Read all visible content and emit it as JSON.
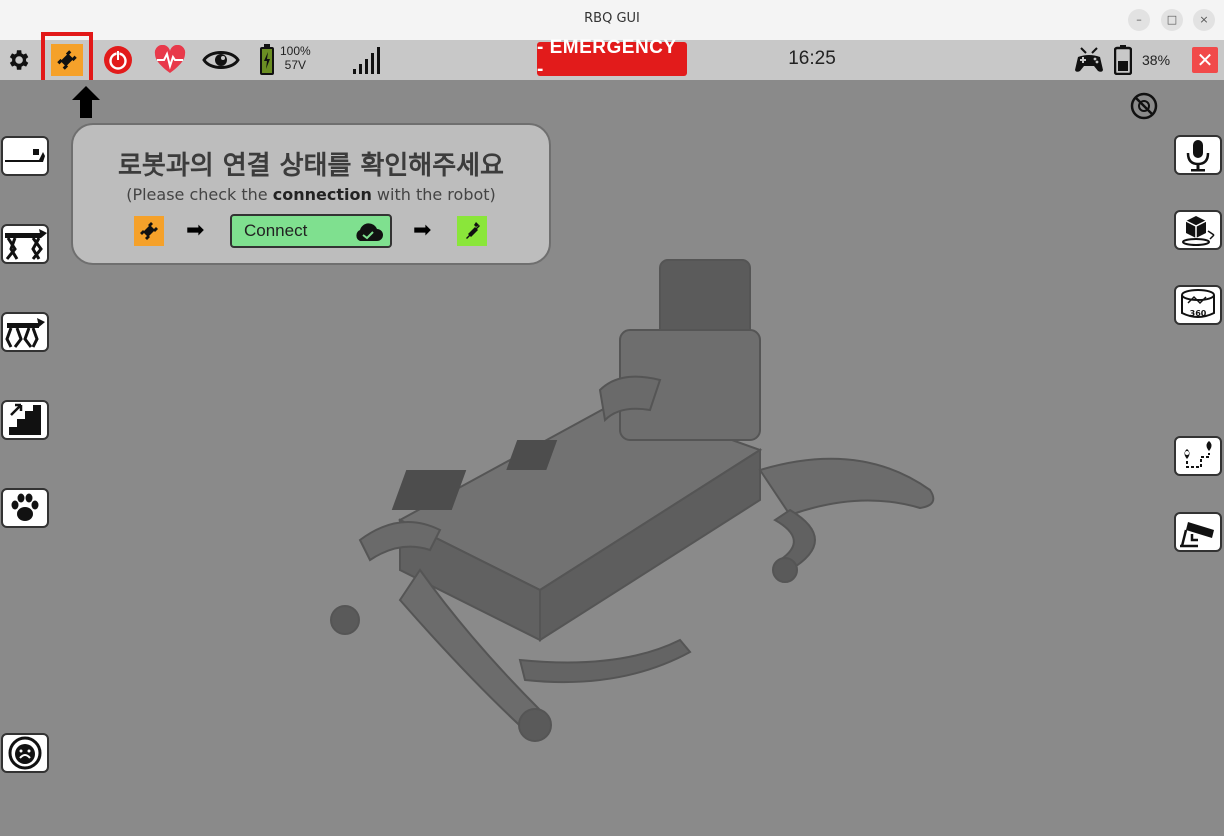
{
  "window": {
    "title": "RBQ GUI",
    "controls": [
      "–",
      "□",
      "×"
    ]
  },
  "toolbar": {
    "battery_percent": "100%",
    "battery_voltage": "57V",
    "emergency_label": "- EMERGENCY -",
    "time": "16:25",
    "controller_battery": "38%",
    "close_label": "✕",
    "colors": {
      "emergency": "#e21b1b",
      "highlight": "#e21818",
      "plug_orange": "#f5a12a"
    }
  },
  "hint": {
    "title_ko": "로봇과의 연결 상태를 확인해주세요",
    "subtitle_prefix": "(Please check the ",
    "subtitle_bold": "connection",
    "subtitle_suffix": " with the robot)",
    "connect_label": "Connect"
  },
  "icons": {
    "left": [
      "lie-down-icon",
      "stand-icon",
      "walk-icon",
      "stairs-icon",
      "paw-icon",
      "emergency-stop-icon"
    ],
    "right": [
      "microphone-icon",
      "3d-view-icon",
      "360-view-icon",
      "waypoint-icon",
      "camera-icon"
    ]
  }
}
